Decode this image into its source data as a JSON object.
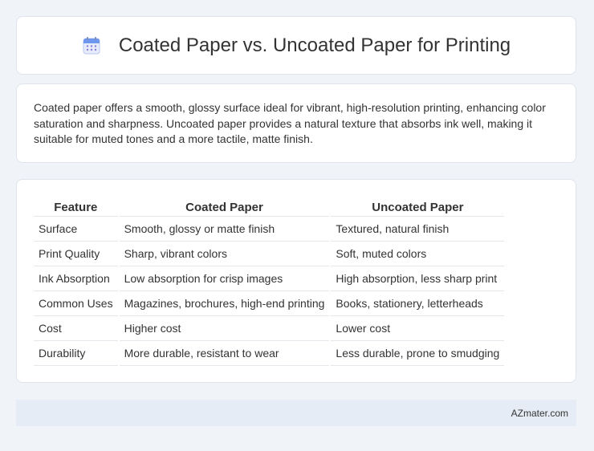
{
  "header": {
    "title": "Coated Paper vs. Uncoated Paper for Printing",
    "icon": "calendar-icon"
  },
  "intro": {
    "text": "Coated paper offers a smooth, glossy surface ideal for vibrant, high-resolution printing, enhancing color saturation and sharpness. Uncoated paper provides a natural texture that absorbs ink well, making it suitable for muted tones and a more tactile, matte finish."
  },
  "table": {
    "headers": [
      "Feature",
      "Coated Paper",
      "Uncoated Paper"
    ],
    "rows": [
      [
        "Surface",
        "Smooth, glossy or matte finish",
        "Textured, natural finish"
      ],
      [
        "Print Quality",
        "Sharp, vibrant colors",
        "Soft, muted colors"
      ],
      [
        "Ink Absorption",
        "Low absorption for crisp images",
        "High absorption, less sharp print"
      ],
      [
        "Common Uses",
        "Magazines, brochures, high-end printing",
        "Books, stationery, letterheads"
      ],
      [
        "Cost",
        "Higher cost",
        "Lower cost"
      ],
      [
        "Durability",
        "More durable, resistant to wear",
        "Less durable, prone to smudging"
      ]
    ]
  },
  "footer": {
    "text": "AZmater.com"
  },
  "colors": {
    "background": "#f0f3f8",
    "footer_bg": "#e6ecf5",
    "icon_blue": "#5b8def"
  }
}
